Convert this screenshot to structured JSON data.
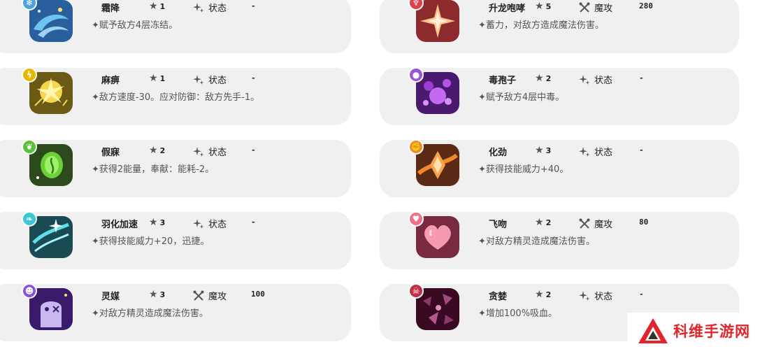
{
  "skills": [
    {
      "name": "霜降",
      "rank": "1",
      "category": "状态",
      "power": "-",
      "description": "✦赋予敌方4层冻结。",
      "element": "ice",
      "element_color": "#4aa3e0",
      "icon": "frost-swirl-icon",
      "bg": "#2f6fb0"
    },
    {
      "name": "升龙咆哮",
      "rank": "5",
      "category": "魔攻",
      "power": "280",
      "description": "✦蓄力，对敌方造成魔法伤害。",
      "element": "dragon",
      "element_color": "#e0404a",
      "icon": "radiant-star-icon",
      "bg": "#8c2a2e"
    },
    {
      "name": "麻痹",
      "rank": "1",
      "category": "状态",
      "power": "-",
      "description": "✦敌方速度-30。应对防御：敌方先手-1。",
      "element": "electric",
      "element_color": "#e6b800",
      "icon": "electric-burst-icon",
      "bg": "#6b5a14"
    },
    {
      "name": "毒孢子",
      "rank": "2",
      "category": "状态",
      "power": "-",
      "description": "✦赋予敌方4层中毒。",
      "element": "poison",
      "element_color": "#9a55d6",
      "icon": "poison-spore-icon",
      "bg": "#4a1a6e"
    },
    {
      "name": "假寐",
      "rank": "2",
      "category": "状态",
      "power": "-",
      "description": "✦获得2能量，奉献：能耗-2。",
      "element": "grass",
      "element_color": "#5cbf3a",
      "icon": "leaf-orb-icon",
      "bg": "#2d4a1c"
    },
    {
      "name": "化劲",
      "rank": "3",
      "category": "状态",
      "power": "-",
      "description": "✦获得技能威力+40。",
      "element": "fighting",
      "element_color": "#f08a2a",
      "icon": "orange-diamond-icon",
      "bg": "#5a2a14"
    },
    {
      "name": "羽化加速",
      "rank": "3",
      "category": "状态",
      "power": "-",
      "description": "✦获得技能威力+20，迅捷。",
      "element": "wind",
      "element_color": "#3cc7d6",
      "icon": "wind-streak-icon",
      "bg": "#1a4a52"
    },
    {
      "name": "飞吻",
      "rank": "2",
      "category": "魔攻",
      "power": "80",
      "description": "✦对敌方精灵造成魔法伤害。",
      "element": "fairy",
      "element_color": "#f0708a",
      "icon": "pink-heart-icon",
      "bg": "#7a2a3e"
    },
    {
      "name": "灵媒",
      "rank": "3",
      "category": "魔攻",
      "power": "100",
      "description": "✦对敌方精灵造成魔法伤害。",
      "element": "ghost",
      "element_color": "#8a4fe0",
      "icon": "ghost-figure-icon",
      "bg": "#3a1a6a"
    },
    {
      "name": "贪婪",
      "rank": "2",
      "category": "状态",
      "power": "-",
      "description": "✦增加100%吸血。",
      "element": "dark",
      "element_color": "#c0304a",
      "icon": "dark-shards-icon",
      "bg": "#3a0a22"
    }
  ],
  "watermark": {
    "text": "科维手游网"
  }
}
